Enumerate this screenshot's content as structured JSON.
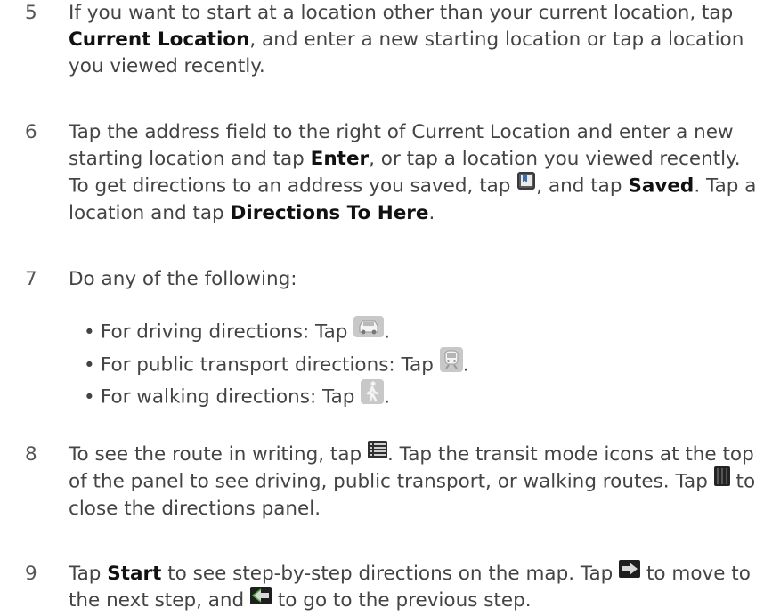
{
  "steps": [
    {
      "num": "5",
      "p1": "If you want to start at a location other than your current location, tap ",
      "b1": "Current Location",
      "p2": ", and enter a new starting location or tap a location you viewed recently."
    },
    {
      "num": "6",
      "p1": "Tap the address field to the right of Current Location and enter a new starting location and tap ",
      "b1": "Enter",
      "p2": ", or tap a location you viewed recently. To get directions to an address you saved, tap ",
      "p3": ", and tap ",
      "b2": "Saved",
      "p4": ". Tap a location and tap ",
      "b3": "Directions To Here",
      "p5": "."
    },
    {
      "num": "7",
      "p1": "Do any of the following:",
      "bullets": [
        "For driving directions: Tap ",
        "For public transport directions: Tap ",
        "For walking directions: Tap "
      ]
    },
    {
      "num": "8",
      "p1": "To see the route in writing, tap ",
      "p2": ". Tap the transit mode icons at the top of the panel to see driving, public transport, or walking routes. Tap ",
      "p3": " to close the directions panel."
    },
    {
      "num": "9",
      "p1": "Tap ",
      "b1": "Start",
      "p2": " to see step-by-step directions on the map. Tap ",
      "p3": " to move to the next step, and ",
      "p4": " to go to the previous step."
    }
  ],
  "bullet_char": "•",
  "period": ".",
  "icons": {
    "bookmarks": "bookmarks-icon",
    "car": "car-icon",
    "transit": "train-icon",
    "walk": "walking-icon",
    "list": "list-icon",
    "close_panel": "panel-close-icon",
    "next": "arrow-right-icon",
    "prev": "arrow-left-icon"
  }
}
